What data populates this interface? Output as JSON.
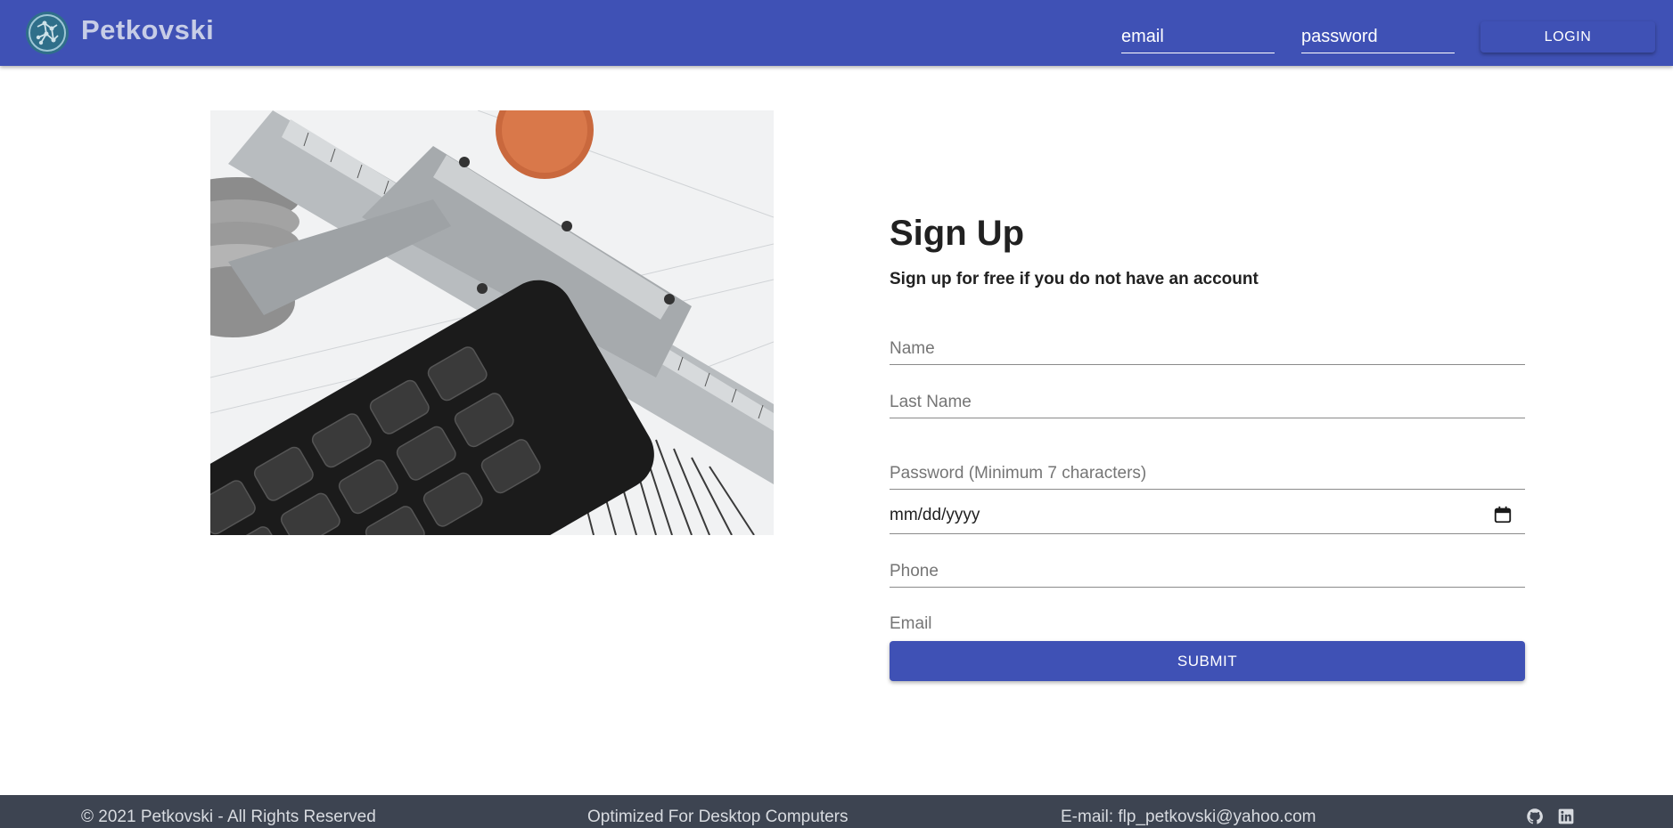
{
  "navbar": {
    "brand": "Petkovski",
    "logo_icon": "network-globe-logo-icon",
    "email_placeholder": "email",
    "password_placeholder": "password",
    "login_label": "LOGIN",
    "background": "#3f51b5"
  },
  "hero": {
    "image": "calipers-calculator-coins-photo"
  },
  "signup": {
    "title": "Sign Up",
    "subtitle": "Sign up for free if you do not have an account",
    "name_placeholder": "Name",
    "last_name_placeholder": "Last Name",
    "password_placeholder": "Password (Minimum 7 characters)",
    "date_placeholder": "mm/dd/yyyy",
    "date_icon": "calendar-icon",
    "phone_placeholder": "Phone",
    "email_placeholder": "Email",
    "submit_label": "SUBMIT",
    "accent": "#3f51b5"
  },
  "footer": {
    "copyright": "© 2021 Petkovski - All Rights Reserved",
    "optimized": "Optimized For Desktop Computers",
    "email": "E-mail: flp_petkovski@yahoo.com",
    "icons": [
      "github-icon",
      "linkedin-icon"
    ],
    "background": "#3d4451"
  }
}
